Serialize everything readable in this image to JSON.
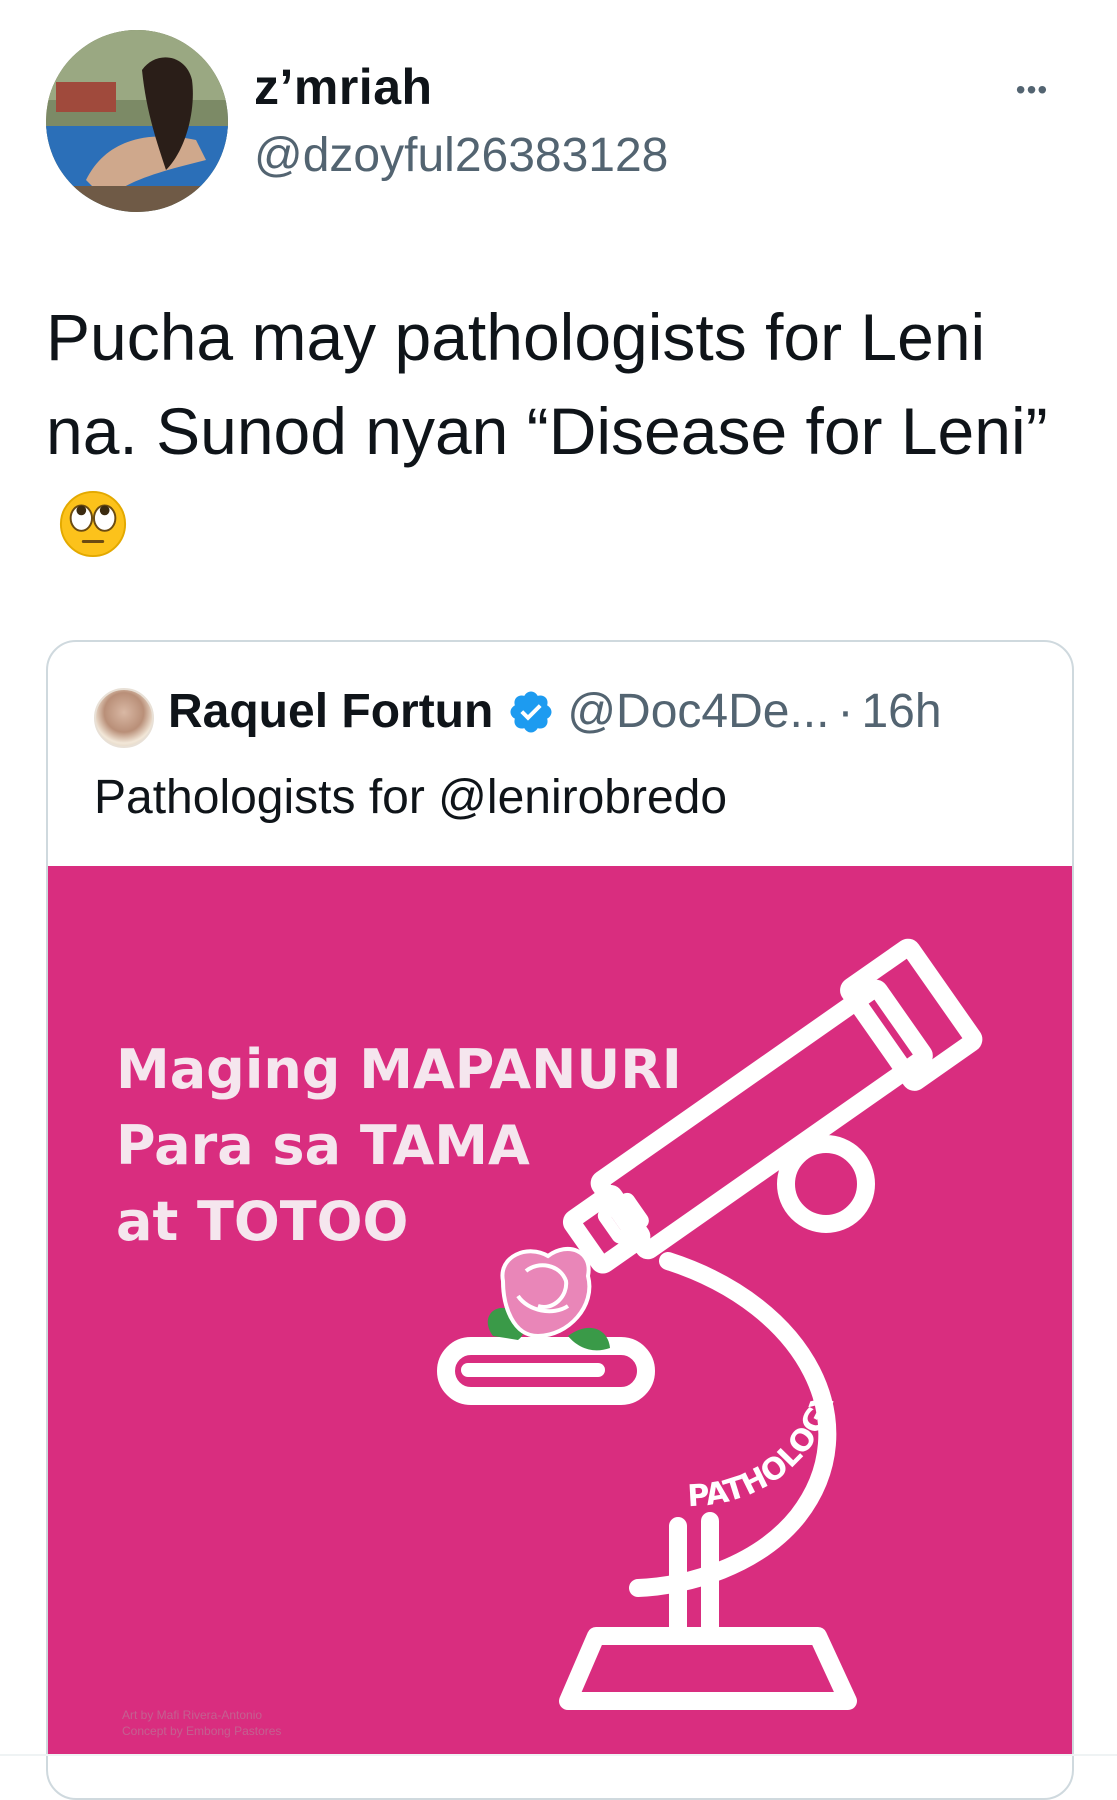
{
  "tweet": {
    "display_name": "z’mriah",
    "handle": "@dzoyful26383128",
    "more_label": "•••",
    "text": "Pucha may pathologists for Leni na. Sunod nyan “Disease for Leni”",
    "emoji": "face-with-rolling-eyes"
  },
  "quoted_tweet": {
    "display_name": "Raquel Fortun",
    "verified": true,
    "handle": "@Doc4De...",
    "separator": "·",
    "time": "16h",
    "text": "Pathologists for @lenirobredo",
    "image": {
      "background_color": "#d92d7f",
      "headline_lines": [
        "Maging MAPANURI",
        "Para sa TAMA",
        "at TOTOO"
      ],
      "microscope_label": "PATHOLOGY",
      "credits": [
        "Art by Mafi Rivera-Antonio",
        "Concept by Embong Pastores"
      ]
    }
  },
  "colors": {
    "text_primary": "#0f1419",
    "text_secondary": "#536471",
    "verified_blue": "#1d9bf0",
    "border": "#cfd9de"
  }
}
